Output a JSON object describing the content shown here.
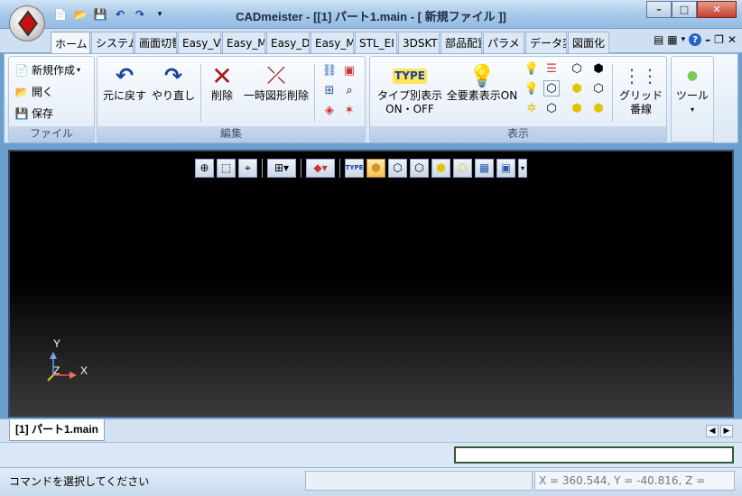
{
  "window": {
    "title": "CADmeister - [[1] パート1.main - [ 新規ファイル ]]",
    "buttons": {
      "minimize": "–",
      "maximize": "□",
      "close": "✕"
    }
  },
  "quick_access": {
    "icons": [
      "new-file-icon",
      "open-folder-icon",
      "save-icon",
      "undo-icon",
      "redo-icon",
      "dropdown-icon"
    ]
  },
  "tabs": [
    {
      "label": "ホーム",
      "active": true
    },
    {
      "label": "システム"
    },
    {
      "label": "画面切替"
    },
    {
      "label": "Easy_V"
    },
    {
      "label": "Easy_M"
    },
    {
      "label": "Easy_D"
    },
    {
      "label": "Easy_M"
    },
    {
      "label": "STL_EI"
    },
    {
      "label": "3DSKT"
    },
    {
      "label": "部品配置"
    },
    {
      "label": "パラメ"
    },
    {
      "label": "データ変"
    },
    {
      "label": "図面化"
    }
  ],
  "ribbon": {
    "file_group": {
      "label": "ファイル",
      "new": "新規作成",
      "open": "開く",
      "save": "保存"
    },
    "edit_group": {
      "label": "編集",
      "undo": "元に戻す",
      "redo": "やり直し",
      "delete": "削除",
      "temp_delete": "一時図形削除"
    },
    "display_group": {
      "label": "表示",
      "type_display_line1": "タイプ別表示",
      "type_display_line2": "ON・OFF",
      "type_icon_text": "TYPE",
      "all_display": "全要素表示ON",
      "grid_line1": "グリッド",
      "grid_line2": "番線"
    },
    "tools_group": {
      "label": "ツール"
    }
  },
  "viewport": {
    "axis_x": "X",
    "axis_y": "Y",
    "axis_z": "Z",
    "toolbar_type_icon_text": "TYPE"
  },
  "doc_tab": "[1] パート1.main",
  "status": {
    "message": "コマンドを選択してください",
    "coords": "X =   360.544, Y =  -40.816, Z ="
  },
  "colors": {
    "accent": "#c81010",
    "ribbon_label_bg": "#b7cbe5",
    "command_border": "#2f5b39"
  }
}
